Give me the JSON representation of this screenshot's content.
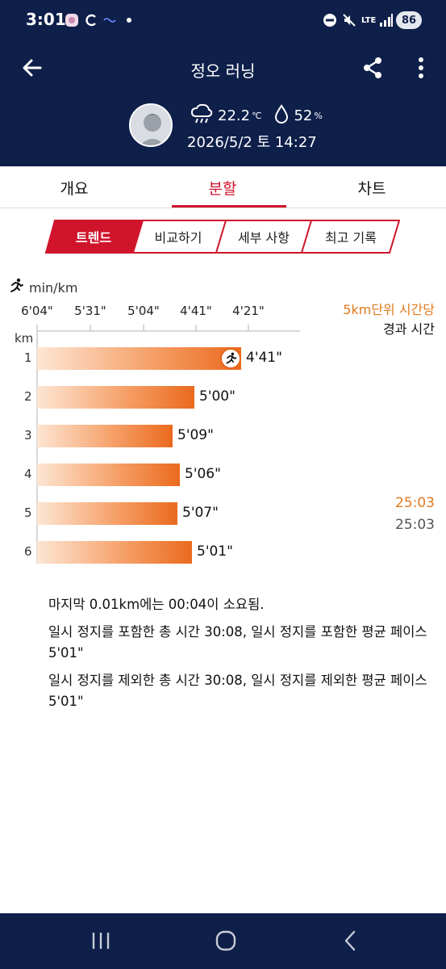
{
  "status_bar": {
    "time": "3:01",
    "battery": "86",
    "network": "LTE"
  },
  "app_bar": {
    "title": "정오 러닝",
    "back_icon": "arrow-left-icon",
    "share_icon": "share-icon",
    "more_icon": "more-vertical-icon"
  },
  "summary": {
    "temperature": "22.2",
    "temperature_unit": "℃",
    "humidity": "52",
    "humidity_unit": "%",
    "datetime": "2026/5/2 토 14:27"
  },
  "tabs": [
    {
      "label": "개요",
      "active": false
    },
    {
      "label": "분할",
      "active": true
    },
    {
      "label": "차트",
      "active": false
    }
  ],
  "segments": [
    {
      "label": "트렌드",
      "active": true
    },
    {
      "label": "비교하기",
      "active": false
    },
    {
      "label": "세부 사항",
      "active": false
    },
    {
      "label": "최고 기록",
      "active": false
    }
  ],
  "chart_data": {
    "type": "bar",
    "orientation": "horizontal",
    "unit_label": "min/km",
    "row_axis_label": "km",
    "axis_ticks": [
      "6'04\"",
      "5'31\"",
      "5'04\"",
      "4'41\"",
      "4'21\""
    ],
    "axis_range_seconds": [
      364,
      261
    ],
    "categories": [
      "1",
      "2",
      "3",
      "4",
      "5",
      "6"
    ],
    "values_seconds": [
      281,
      300,
      309,
      306,
      307,
      301
    ],
    "value_labels": [
      "4'41\"",
      "5'00\"",
      "5'09\"",
      "5'06\"",
      "5'07\"",
      "5'01\""
    ],
    "fastest_index": 0,
    "bar_color": "#ea6a1d"
  },
  "side_panel": {
    "title_orange": "5km단위 시간당",
    "title_black": "경과 시간",
    "time_orange": "25:03",
    "time_gray": "25:03"
  },
  "notes": [
    "마지막 0.01km에는 00:04이 소요됨.",
    "일시 정지를 포함한 총 시간 30:08, 일시 정지를 포함한 평균 페이스 5'01\"",
    "일시 정지를 제외한 총 시간 30:08, 일시 정지를 제외한 평균 페이스 5'01\""
  ],
  "colors": {
    "header_bg": "#0e1f4a",
    "accent_red": "#d0142c",
    "accent_orange": "#e07a1f"
  }
}
